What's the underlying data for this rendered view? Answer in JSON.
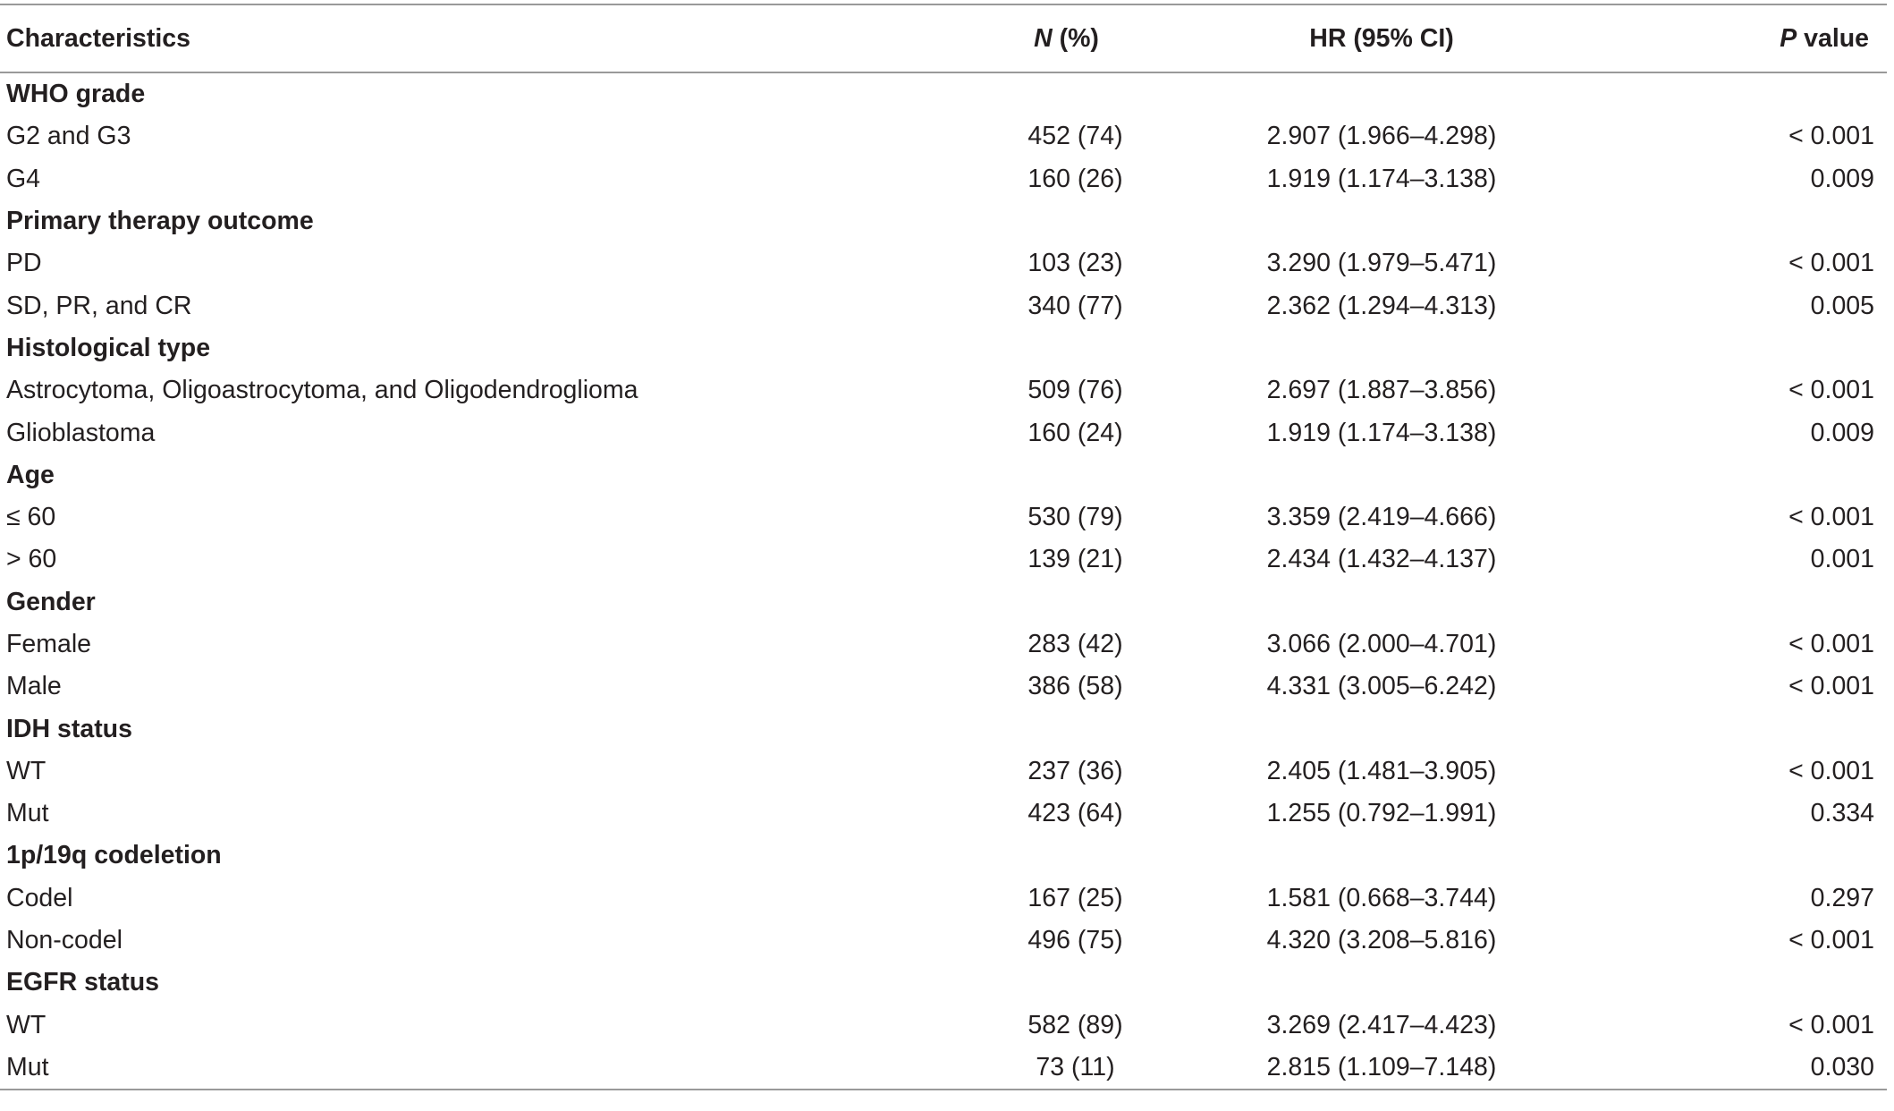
{
  "header": {
    "characteristics": "Characteristics",
    "n_italic": "N",
    "n_rest": " (%)",
    "hr": "HR (95% CI)",
    "p_italic": "P",
    "p_rest": " value"
  },
  "rows": [
    {
      "type": "group",
      "label": "WHO grade"
    },
    {
      "type": "item",
      "label": "G2 and G3",
      "n": "452 (74)",
      "hr": "2.907 (1.966–4.298)",
      "p": "< 0.001"
    },
    {
      "type": "item",
      "label": "G4",
      "n": "160 (26)",
      "hr": "1.919 (1.174–3.138)",
      "p": "0.009"
    },
    {
      "type": "group",
      "label": "Primary therapy outcome"
    },
    {
      "type": "item",
      "label": "PD",
      "n": "103 (23)",
      "hr": "3.290 (1.979–5.471)",
      "p": "< 0.001"
    },
    {
      "type": "item",
      "label": "SD, PR, and CR",
      "n": "340 (77)",
      "hr": "2.362 (1.294–4.313)",
      "p": "0.005"
    },
    {
      "type": "group",
      "label": "Histological type"
    },
    {
      "type": "item",
      "label": "Astrocytoma, Oligoastrocytoma, and Oligodendroglioma",
      "n": "509 (76)",
      "hr": "2.697 (1.887–3.856)",
      "p": "< 0.001"
    },
    {
      "type": "item",
      "label": "Glioblastoma",
      "n": "160 (24)",
      "hr": "1.919 (1.174–3.138)",
      "p": "0.009"
    },
    {
      "type": "group",
      "label": "Age"
    },
    {
      "type": "item",
      "label": "≤ 60",
      "n": "530 (79)",
      "hr": "3.359 (2.419–4.666)",
      "p": "< 0.001"
    },
    {
      "type": "item",
      "label": "> 60",
      "n": "139 (21)",
      "hr": "2.434 (1.432–4.137)",
      "p": "0.001"
    },
    {
      "type": "group",
      "label": "Gender"
    },
    {
      "type": "item",
      "label": "Female",
      "n": "283 (42)",
      "hr": "3.066 (2.000–4.701)",
      "p": "< 0.001"
    },
    {
      "type": "item",
      "label": "Male",
      "n": "386 (58)",
      "hr": "4.331 (3.005–6.242)",
      "p": "< 0.001"
    },
    {
      "type": "group",
      "label": "IDH status"
    },
    {
      "type": "item",
      "label": "WT",
      "n": "237 (36)",
      "hr": "2.405 (1.481–3.905)",
      "p": "< 0.001"
    },
    {
      "type": "item",
      "label": "Mut",
      "n": "423 (64)",
      "hr": "1.255 (0.792–1.991)",
      "p": "0.334"
    },
    {
      "type": "group",
      "label": "1p/19q codeletion"
    },
    {
      "type": "item",
      "label": "Codel",
      "n": "167 (25)",
      "hr": "1.581 (0.668–3.744)",
      "p": "0.297"
    },
    {
      "type": "item",
      "label": "Non-codel",
      "n": "496 (75)",
      "hr": "4.320 (3.208–5.816)",
      "p": "< 0.001"
    },
    {
      "type": "group",
      "label": "EGFR status"
    },
    {
      "type": "item",
      "label": "WT",
      "n": "582 (89)",
      "hr": "3.269 (2.417–4.423)",
      "p": "< 0.001"
    },
    {
      "type": "item",
      "label": "Mut",
      "n": "73 (11)",
      "hr": "2.815 (1.109–7.148)",
      "p": "0.030"
    }
  ]
}
